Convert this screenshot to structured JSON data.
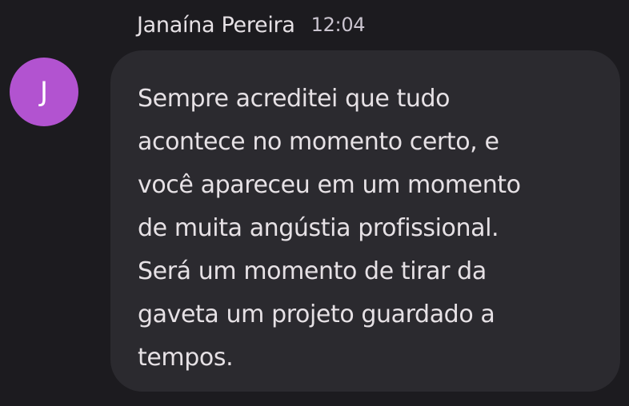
{
  "message": {
    "sender": "Janaína Pereira",
    "time": "12:04",
    "avatar_initial": "J",
    "avatar_color": "#b253d0",
    "text": "Sempre acreditei que tudo\nacontece no momento certo, e\nvocê apareceu em um momento\nde muita angústia profissional.\nSerá um momento de tirar da\ngaveta um projeto guardado a\ntempos."
  }
}
